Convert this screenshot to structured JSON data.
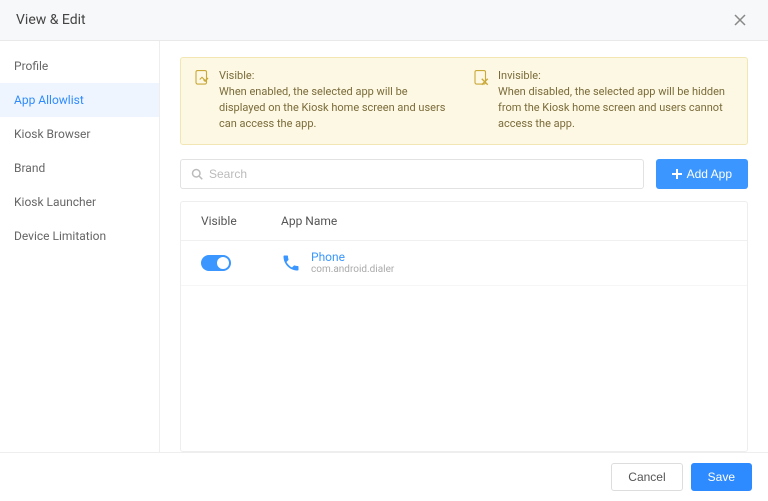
{
  "header": {
    "title": "View & Edit"
  },
  "sidebar": {
    "items": [
      {
        "label": "Profile"
      },
      {
        "label": "App Allowlist"
      },
      {
        "label": "Kiosk Browser"
      },
      {
        "label": "Brand"
      },
      {
        "label": "Kiosk Launcher"
      },
      {
        "label": "Device Limitation"
      }
    ],
    "activeIndex": 1
  },
  "banner": {
    "visible": {
      "title": "Visible:",
      "desc": "When enabled, the selected app will be displayed on the Kiosk home screen and users can access the app."
    },
    "invisible": {
      "title": "Invisible:",
      "desc": "When disabled, the selected app will be hidden from the Kiosk home screen and users cannot access the app."
    }
  },
  "search": {
    "placeholder": "Search"
  },
  "toolbar": {
    "add_label": "Add App"
  },
  "table": {
    "headers": {
      "visible": "Visible",
      "appName": "App Name"
    },
    "rows": [
      {
        "visible": true,
        "name": "Phone",
        "package": "com.android.dialer",
        "icon": "phone-icon"
      }
    ]
  },
  "footer": {
    "cancel": "Cancel",
    "save": "Save"
  }
}
